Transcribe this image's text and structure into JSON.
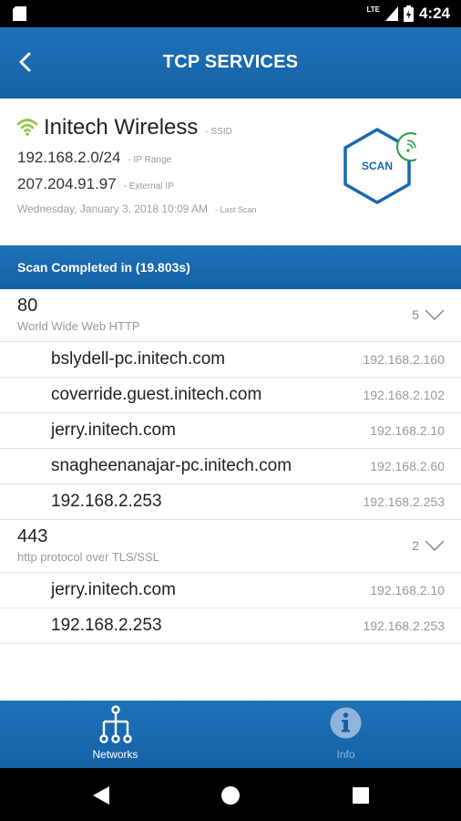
{
  "status_bar": {
    "network": "LTE",
    "time": "4:24"
  },
  "app_bar": {
    "title": "TCP SERVICES"
  },
  "network_info": {
    "ssid": "Initech Wireless",
    "ssid_tag": "- SSID",
    "ip_range": "192.168.2.0/24",
    "ip_range_tag": "- IP Range",
    "external_ip": "207.204.91.97",
    "external_ip_tag": "- External IP",
    "last_scan": "Wednesday, January 3, 2018 10:09 AM",
    "last_scan_tag": "- Last Scan",
    "scan_button_label": "SCAN"
  },
  "banner": {
    "text": "Scan Completed in (19.803s)"
  },
  "services": [
    {
      "port": "80",
      "description": "World Wide Web HTTP",
      "count": "5",
      "hosts": [
        {
          "name": "bslydell-pc.initech.com",
          "ip": "192.168.2.160"
        },
        {
          "name": "coverride.guest.initech.com",
          "ip": "192.168.2.102"
        },
        {
          "name": "jerry.initech.com",
          "ip": "192.168.2.10"
        },
        {
          "name": "snagheenanajar-pc.initech.com",
          "ip": "192.168.2.60"
        },
        {
          "name": "192.168.2.253",
          "ip": "192.168.2.253"
        }
      ]
    },
    {
      "port": "443",
      "description": "http protocol over TLS/SSL",
      "count": "2",
      "hosts": [
        {
          "name": "jerry.initech.com",
          "ip": "192.168.2.10"
        },
        {
          "name": "192.168.2.253",
          "ip": "192.168.2.253"
        }
      ]
    }
  ],
  "bottom_tabs": [
    {
      "label": "Networks",
      "icon": "network-tree-icon",
      "active": true
    },
    {
      "label": "Info",
      "icon": "info-icon",
      "active": false
    }
  ],
  "colors": {
    "brand_blue": "#1a68ad",
    "wifi_green": "#8cc63f",
    "scan_border": "#1a68ad"
  }
}
